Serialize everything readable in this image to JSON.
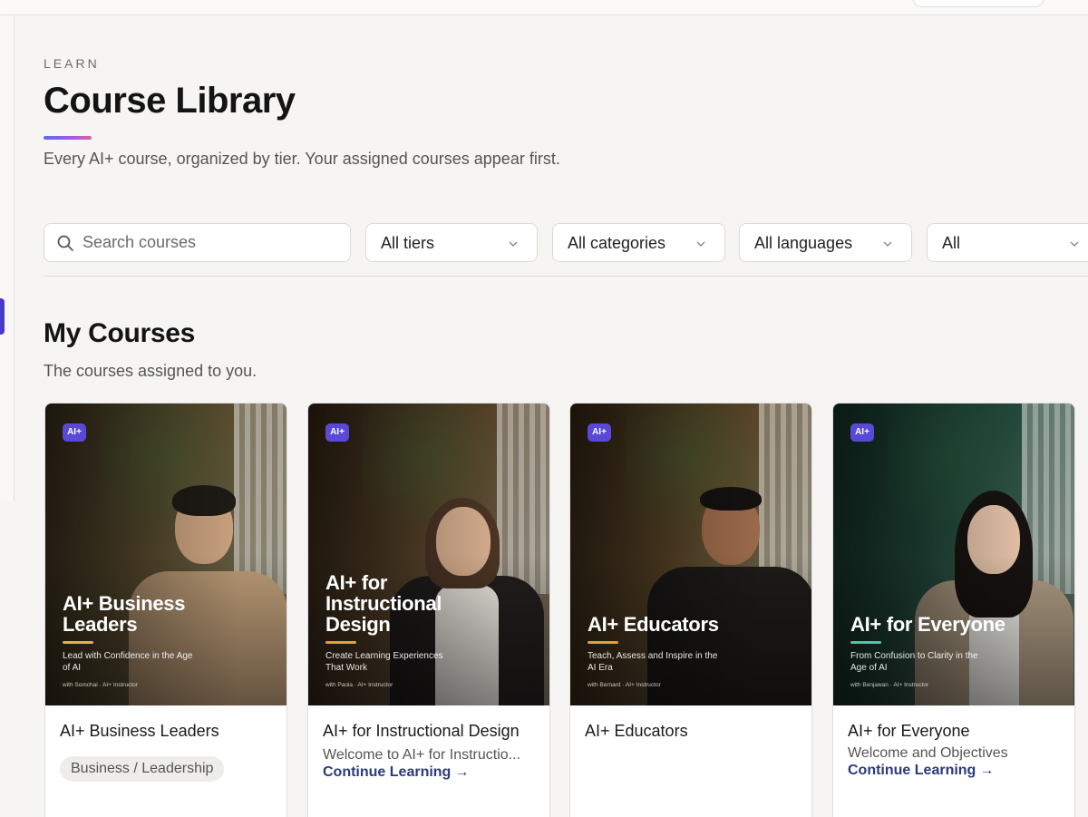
{
  "header": {
    "eyebrow": "LEARN",
    "title": "Course Library",
    "subtitle": "Every AI+ course, organized by tier. Your assigned courses appear first."
  },
  "filters": {
    "search_placeholder": "Search courses",
    "tier": "All tiers",
    "category": "All categories",
    "language": "All languages",
    "status": "All"
  },
  "section": {
    "title": "My Courses",
    "subtitle": "The courses assigned to you."
  },
  "courses": [
    {
      "logo": "AI+",
      "cover_title": "AI+ Business Leaders",
      "cover_tagline": "Lead with Confidence in the Age of AI",
      "instructor": "with Somchai · AI+ Instructor",
      "title": "AI+ Business Leaders",
      "category": "Business / Leadership",
      "accent": "#e0b04a"
    },
    {
      "logo": "AI+",
      "cover_title": "AI+ for Instructional Design",
      "cover_tagline": "Create Learning Experiences That Work",
      "instructor": "with Paola · AI+ Instructor",
      "title": "AI+ for Instructional Design",
      "lesson": "Welcome to AI+ for Instructio...",
      "continue": "Continue Learning",
      "accent": "#e0a040"
    },
    {
      "logo": "AI+",
      "cover_title": "AI+ Educators",
      "cover_tagline": "Teach, Assess and Inspire in the AI Era",
      "instructor": "with Bernard · AI+ Instructor",
      "title": "AI+ Educators",
      "accent": "#e0a040"
    },
    {
      "logo": "AI+",
      "cover_title": "AI+ for Everyone",
      "cover_tagline": "From Confusion to Clarity in the Age of AI",
      "instructor": "with Benjawan · AI+ Instructor",
      "title": "AI+ for Everyone",
      "lesson": "Welcome and Objectives",
      "continue": "Continue Learning",
      "accent": "#4fc3a8"
    }
  ],
  "colors": {
    "brand": "#5a49d6",
    "link": "#2c3a7a"
  }
}
